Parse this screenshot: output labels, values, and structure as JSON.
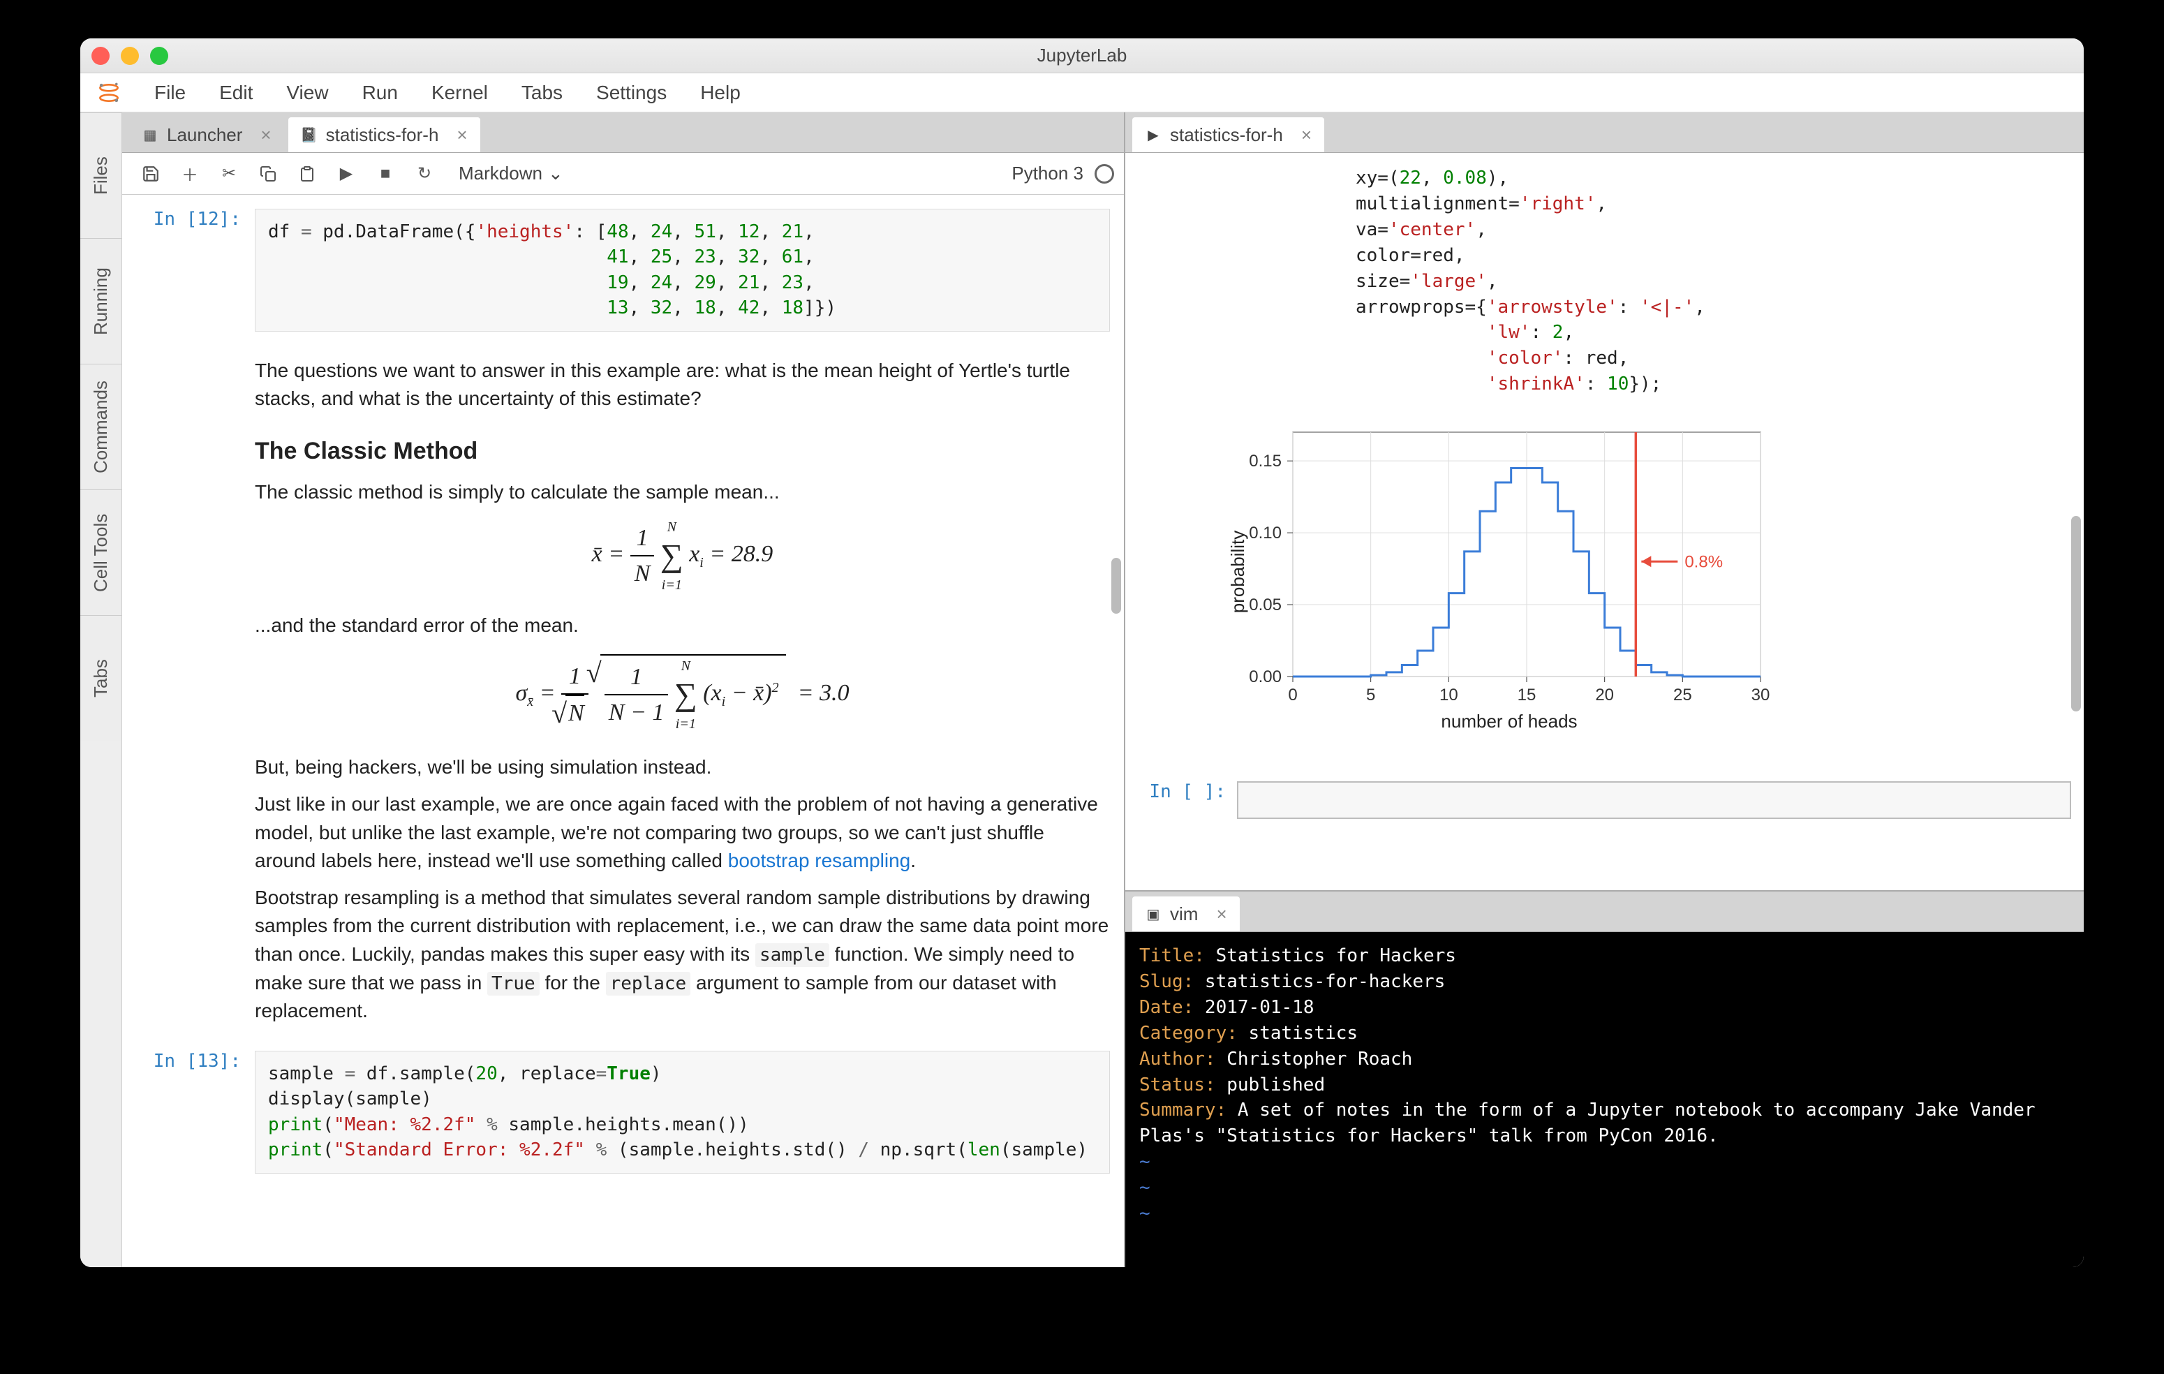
{
  "window": {
    "title": "JupyterLab"
  },
  "menu": [
    "File",
    "Edit",
    "View",
    "Run",
    "Kernel",
    "Tabs",
    "Settings",
    "Help"
  ],
  "sideTabs": [
    "Files",
    "Running",
    "Commands",
    "Cell Tools",
    "Tabs"
  ],
  "left": {
    "tabs": [
      {
        "label": "Launcher",
        "icon": "launcher",
        "active": false
      },
      {
        "label": "statistics-for-h",
        "icon": "notebook",
        "active": true
      }
    ],
    "toolbar": {
      "cellType": "Markdown",
      "kernel": "Python 3"
    },
    "cells": {
      "code1_prompt": "In [12]:",
      "code1_html": "df <span class='tk-o'>=</span> pd.DataFrame({<span class='tk-s'>'heights'</span>: [<span class='tk-n'>48</span>, <span class='tk-n'>24</span>, <span class='tk-n'>51</span>, <span class='tk-n'>12</span>, <span class='tk-n'>21</span>,\n                               <span class='tk-n'>41</span>, <span class='tk-n'>25</span>, <span class='tk-n'>23</span>, <span class='tk-n'>32</span>, <span class='tk-n'>61</span>,\n                               <span class='tk-n'>19</span>, <span class='tk-n'>24</span>, <span class='tk-n'>29</span>, <span class='tk-n'>21</span>, <span class='tk-n'>23</span>,\n                               <span class='tk-n'>13</span>, <span class='tk-n'>32</span>, <span class='tk-n'>18</span>, <span class='tk-n'>42</span>, <span class='tk-n'>18</span>]})",
      "md1_p1": "The questions we want to answer in this example are: what is the mean height of Yertle's turtle stacks, and what is the uncertainty of this estimate?",
      "md1_h": "The Classic Method",
      "md1_p2": "The classic method is simply to calculate the sample mean...",
      "math1_result": "= 28.9",
      "md1_p3": "...and the standard error of the mean.",
      "math2_result": "= 3.0",
      "md1_p4": "But, being hackers, we'll be using simulation instead.",
      "md1_p5a": "Just like in our last example, we are once again faced with the problem of not having a generative model, but unlike the last example, we're not comparing two groups, so we can't just shuffle around labels here, instead we'll use something called ",
      "md1_link": "bootstrap resampling",
      "md1_p5b": ".",
      "md1_p6a": "Bootstrap resampling is a method that simulates several random sample distributions by drawing samples from the current distribution with replacement, i.e., we can draw the same data point more than once. Luckily, pandas makes this super easy with its ",
      "md1_code1": "sample",
      "md1_p6b": " function. We simply need to make sure that we pass in ",
      "md1_code2": "True",
      "md1_p6c": " for the ",
      "md1_code3": "replace",
      "md1_p6d": " argument to sample from our dataset with replacement.",
      "code2_prompt": "In [13]:",
      "code2_html": "sample <span class='tk-o'>=</span> df.sample(<span class='tk-n'>20</span>, replace<span class='tk-o'>=</span><span class='tk-k'>True</span>)\ndisplay(sample)\n<span class='tk-bf'>print</span>(<span class='tk-s'>\"Mean: %2.2f\"</span> <span class='tk-o'>%</span> sample.heights.mean())\n<span class='tk-bf'>print</span>(<span class='tk-s'>\"Standard Error: %2.2f\"</span> <span class='tk-o'>%</span> (sample.heights.std() <span class='tk-o'>/</span> np.sqrt(<span class='tk-bf'>len</span>(sample)"
    }
  },
  "right": {
    "tabs": [
      {
        "label": "statistics-for-h",
        "icon": "console",
        "active": true
      }
    ],
    "code_html": "xy=(<span class='tk-n'>22</span>, <span class='tk-n'>0.08</span>),\nmultialignment=<span class='tk-s'>'right'</span>,\nva=<span class='tk-s'>'center'</span>,\ncolor=red,\nsize=<span class='tk-s'>'large'</span>,\narrowprops={<span class='tk-s'>'arrowstyle'</span>: <span class='tk-s'>'<|-'</span>,\n            <span class='tk-s'>'lw'</span>: <span class='tk-n'>2</span>,\n            <span class='tk-s'>'color'</span>: red,\n            <span class='tk-s'>'shrinkA'</span>: <span class='tk-n'>10</span>});",
    "empty_prompt": "In [ ]:",
    "term_tab": "vim",
    "term_lines": [
      "Title: Statistics for Hackers",
      "Slug: statistics-for-hackers",
      "Date: 2017-01-18",
      "Category: statistics",
      "Author: Christopher Roach",
      "Status: published",
      "Summary: A set of notes in the form of a Jupyter notebook to accompany Jake Vander Plas's \"Statistics for Hackers\" talk from PyCon 2016."
    ]
  },
  "chart_data": {
    "type": "line-step",
    "title": "",
    "xlabel": "number of heads",
    "ylabel": "probability",
    "xlim": [
      0,
      30
    ],
    "ylim": [
      0,
      0.17
    ],
    "xticks": [
      0,
      5,
      10,
      15,
      20,
      25,
      30
    ],
    "yticks": [
      0.0,
      0.05,
      0.1,
      0.15
    ],
    "x": [
      0,
      1,
      2,
      3,
      4,
      5,
      6,
      7,
      8,
      9,
      10,
      11,
      12,
      13,
      14,
      15,
      16,
      17,
      18,
      19,
      20,
      21,
      22,
      23,
      24,
      25,
      26,
      27,
      28,
      29,
      30
    ],
    "y": [
      0.0,
      0.0,
      0.0,
      0.0,
      0.0,
      0.001,
      0.003,
      0.008,
      0.018,
      0.034,
      0.058,
      0.087,
      0.115,
      0.135,
      0.145,
      0.145,
      0.135,
      0.115,
      0.087,
      0.058,
      0.034,
      0.018,
      0.008,
      0.003,
      0.001,
      0.0,
      0.0,
      0.0,
      0.0,
      0.0,
      0.0
    ],
    "annotation": {
      "x": 22,
      "label": "0.8%",
      "color": "#e74c3c"
    },
    "vline": {
      "x": 22,
      "color": "#e74c3c"
    }
  }
}
